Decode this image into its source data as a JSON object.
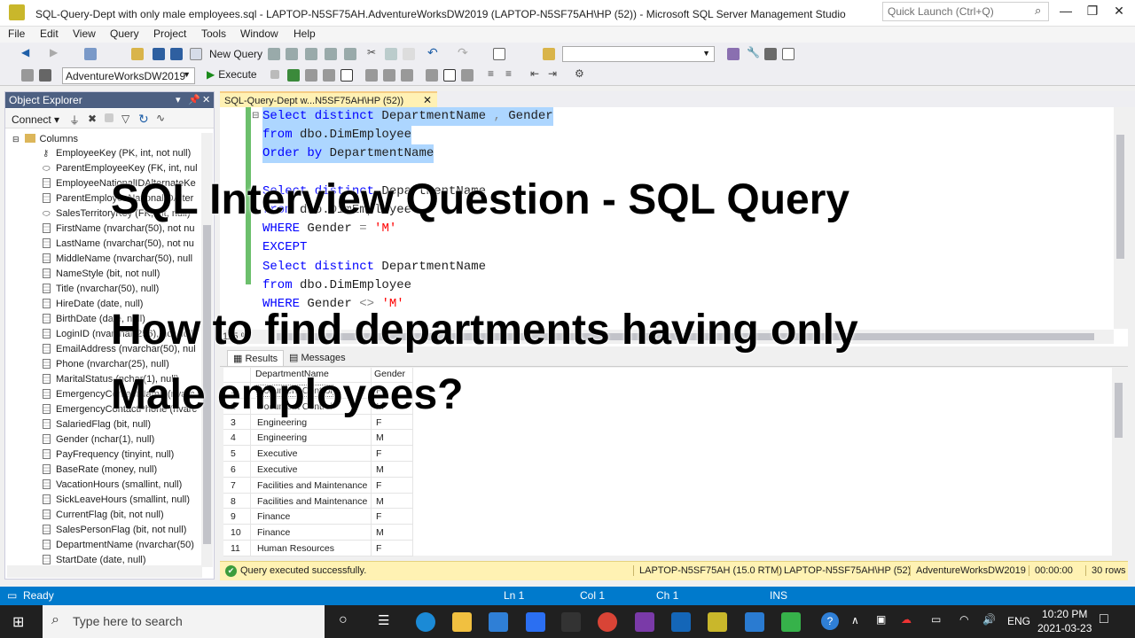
{
  "window": {
    "title": "SQL-Query-Dept with only male employees.sql - LAPTOP-N5SF75AH.AdventureWorksDW2019 (LAPTOP-N5SF75AH\\HP (52)) - Microsoft SQL Server Management Studio",
    "quick_launch_placeholder": "Quick Launch (Ctrl+Q)"
  },
  "menu": [
    "File",
    "Edit",
    "View",
    "Query",
    "Project",
    "Tools",
    "Window",
    "Help"
  ],
  "toolbar": {
    "new_query": "New Query",
    "database": "AdventureWorksDW2019",
    "execute": "Execute"
  },
  "object_explorer": {
    "title": "Object Explorer",
    "connect": "Connect",
    "folder": "Columns",
    "columns": [
      {
        "icon": "key-icon",
        "label": "EmployeeKey (PK, int, not null)"
      },
      {
        "icon": "foreign-key-icon",
        "label": "ParentEmployeeKey (FK, int, nul"
      },
      {
        "icon": "column-icon",
        "label": "EmployeeNationalIDAlternateKe"
      },
      {
        "icon": "column-icon",
        "label": "ParentEmployeeNationalIDAlter"
      },
      {
        "icon": "foreign-key-icon",
        "label": "SalesTerritoryKey (FK, int, null)"
      },
      {
        "icon": "column-icon",
        "label": "FirstName (nvarchar(50), not nu"
      },
      {
        "icon": "column-icon",
        "label": "LastName (nvarchar(50), not nu"
      },
      {
        "icon": "column-icon",
        "label": "MiddleName (nvarchar(50), null"
      },
      {
        "icon": "column-icon",
        "label": "NameStyle (bit, not null)"
      },
      {
        "icon": "column-icon",
        "label": "Title (nvarchar(50), null)"
      },
      {
        "icon": "column-icon",
        "label": "HireDate (date, null)"
      },
      {
        "icon": "column-icon",
        "label": "BirthDate (date, null)"
      },
      {
        "icon": "column-icon",
        "label": "LoginID (nvarchar(256), not null"
      },
      {
        "icon": "column-icon",
        "label": "EmailAddress (nvarchar(50), nul"
      },
      {
        "icon": "column-icon",
        "label": "Phone (nvarchar(25), null)"
      },
      {
        "icon": "column-icon",
        "label": "MaritalStatus (nchar(1), null)"
      },
      {
        "icon": "column-icon",
        "label": "EmergencyContactName (nvarc"
      },
      {
        "icon": "column-icon",
        "label": "EmergencyContactPhone (nvarc"
      },
      {
        "icon": "column-icon",
        "label": "SalariedFlag (bit, null)"
      },
      {
        "icon": "column-icon",
        "label": "Gender (nchar(1), null)"
      },
      {
        "icon": "column-icon",
        "label": "PayFrequency (tinyint, null)"
      },
      {
        "icon": "column-icon",
        "label": "BaseRate (money, null)"
      },
      {
        "icon": "column-icon",
        "label": "VacationHours (smallint, null)"
      },
      {
        "icon": "column-icon",
        "label": "SickLeaveHours (smallint, null)"
      },
      {
        "icon": "column-icon",
        "label": "CurrentFlag (bit, not null)"
      },
      {
        "icon": "column-icon",
        "label": "SalesPersonFlag (bit, not null)"
      },
      {
        "icon": "column-icon",
        "label": "DepartmentName (nvarchar(50)"
      },
      {
        "icon": "column-icon",
        "label": "StartDate (date, null)"
      }
    ]
  },
  "document_tab": "SQL-Query-Dept w...N5SF75AH\\HP (52))",
  "code_lines": [
    {
      "parts": [
        [
          "kw",
          "Select distinct "
        ],
        [
          "id",
          "DepartmentName "
        ],
        [
          "gr",
          ", "
        ],
        [
          "id",
          "Gender"
        ]
      ],
      "selected": true
    },
    {
      "parts": [
        [
          "kw",
          "from "
        ],
        [
          "id",
          "dbo.DimEmployee"
        ]
      ],
      "selected": true
    },
    {
      "parts": [
        [
          "kw",
          "Order by "
        ],
        [
          "id",
          "DepartmentName"
        ]
      ],
      "selected": true
    },
    {
      "parts": [],
      "selected": false
    },
    {
      "parts": [
        [
          "kw",
          "Select distinct "
        ],
        [
          "id",
          "DepartmentName"
        ]
      ],
      "selected": false
    },
    {
      "parts": [
        [
          "kw",
          "from "
        ],
        [
          "id",
          "dbo.DimEmployee"
        ]
      ],
      "selected": false
    },
    {
      "parts": [
        [
          "kw",
          "WHERE "
        ],
        [
          "id",
          "Gender "
        ],
        [
          "gr",
          "= "
        ],
        [
          "str",
          "'M'"
        ]
      ],
      "selected": false
    },
    {
      "parts": [
        [
          "kw",
          "EXCEPT"
        ]
      ],
      "selected": false
    },
    {
      "parts": [
        [
          "kw",
          "Select distinct "
        ],
        [
          "id",
          "DepartmentName"
        ]
      ],
      "selected": false
    },
    {
      "parts": [
        [
          "kw",
          "from "
        ],
        [
          "id",
          "dbo.DimEmployee"
        ]
      ],
      "selected": false
    },
    {
      "parts": [
        [
          "kw",
          "WHERE "
        ],
        [
          "id",
          "Gender "
        ],
        [
          "gr",
          "<> "
        ],
        [
          "str",
          "'M'"
        ]
      ],
      "selected": false
    }
  ],
  "zoom": "115 %",
  "result_tabs": {
    "results": "Results",
    "messages": "Messages"
  },
  "grid": {
    "columns": [
      "DepartmentName",
      "Gender"
    ],
    "rows": [
      [
        "1",
        "Document Control",
        "F"
      ],
      [
        "2",
        "Document Control",
        "M"
      ],
      [
        "3",
        "Engineering",
        "F"
      ],
      [
        "4",
        "Engineering",
        "M"
      ],
      [
        "5",
        "Executive",
        "F"
      ],
      [
        "6",
        "Executive",
        "M"
      ],
      [
        "7",
        "Facilities and Maintenance",
        "F"
      ],
      [
        "8",
        "Facilities and Maintenance",
        "M"
      ],
      [
        "9",
        "Finance",
        "F"
      ],
      [
        "10",
        "Finance",
        "M"
      ],
      [
        "11",
        "Human Resources",
        "F"
      ]
    ]
  },
  "query_status": {
    "message": "Query executed successfully.",
    "server": "LAPTOP-N5SF75AH (15.0 RTM)",
    "user": "LAPTOP-N5SF75AH\\HP (52)",
    "database": "AdventureWorksDW2019",
    "elapsed": "00:00:00",
    "rows": "30 rows"
  },
  "statusbar": {
    "state": "Ready",
    "ln": "Ln 1",
    "col": "Col 1",
    "ch": "Ch 1",
    "mode": "INS"
  },
  "taskbar": {
    "search_placeholder": "Type here to search",
    "lang": "ENG",
    "time": "10:20 PM",
    "date": "2021-03-23"
  },
  "overlay": {
    "line1": "SQL Interview Question - SQL Query",
    "line2": "How to find departments having only",
    "line3": "Male employees?"
  }
}
